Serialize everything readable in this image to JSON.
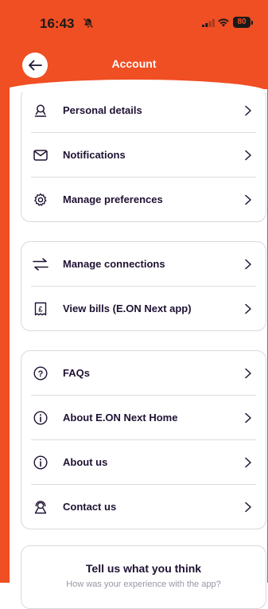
{
  "status_bar": {
    "time": "16:43",
    "battery": "80"
  },
  "header": {
    "title": "Account"
  },
  "groups": [
    {
      "items": [
        {
          "label": "Personal details",
          "icon": "person-icon"
        },
        {
          "label": "Notifications",
          "icon": "envelope-icon"
        },
        {
          "label": "Manage preferences",
          "icon": "gear-icon"
        }
      ]
    },
    {
      "items": [
        {
          "label": "Manage connections",
          "icon": "swap-arrows-icon"
        },
        {
          "label": "View bills (E.ON Next app)",
          "icon": "receipt-pound-icon"
        }
      ]
    },
    {
      "items": [
        {
          "label": "FAQs",
          "icon": "question-circle-icon"
        },
        {
          "label": "About E.ON Next Home",
          "icon": "info-circle-icon"
        },
        {
          "label": "About us",
          "icon": "info-circle-icon"
        },
        {
          "label": "Contact us",
          "icon": "support-agent-icon"
        }
      ]
    }
  ],
  "feedback": {
    "title": "Tell us what you think",
    "subtitle": "How was your experience with the app?"
  },
  "colors": {
    "brand": "#f04e23",
    "text": "#1f1233",
    "divider": "#dcdce0"
  }
}
